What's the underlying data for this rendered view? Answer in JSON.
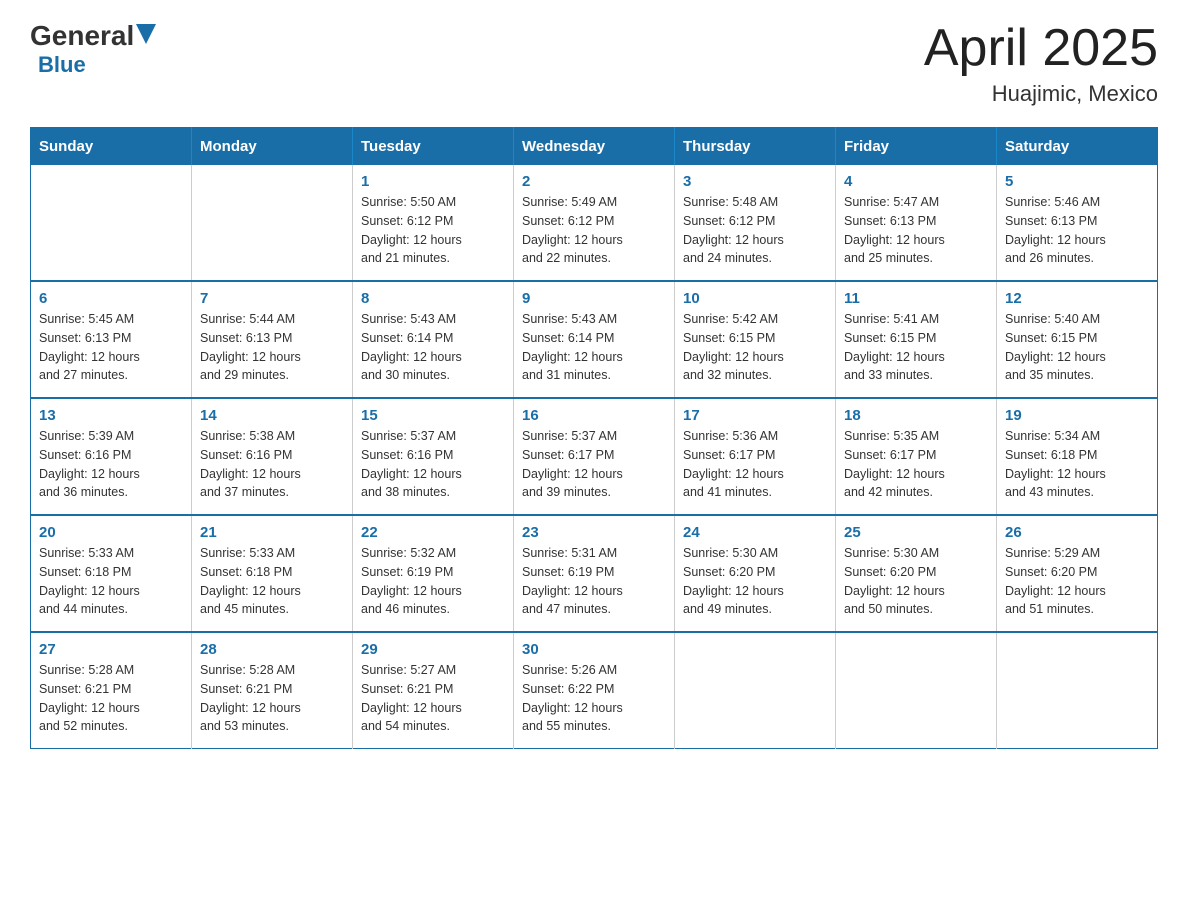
{
  "logo": {
    "general": "General",
    "blue": "Blue"
  },
  "title": {
    "month": "April 2025",
    "location": "Huajimic, Mexico"
  },
  "weekdays": [
    "Sunday",
    "Monday",
    "Tuesday",
    "Wednesday",
    "Thursday",
    "Friday",
    "Saturday"
  ],
  "weeks": [
    [
      {
        "day": "",
        "info": ""
      },
      {
        "day": "",
        "info": ""
      },
      {
        "day": "1",
        "info": "Sunrise: 5:50 AM\nSunset: 6:12 PM\nDaylight: 12 hours\nand 21 minutes."
      },
      {
        "day": "2",
        "info": "Sunrise: 5:49 AM\nSunset: 6:12 PM\nDaylight: 12 hours\nand 22 minutes."
      },
      {
        "day": "3",
        "info": "Sunrise: 5:48 AM\nSunset: 6:12 PM\nDaylight: 12 hours\nand 24 minutes."
      },
      {
        "day": "4",
        "info": "Sunrise: 5:47 AM\nSunset: 6:13 PM\nDaylight: 12 hours\nand 25 minutes."
      },
      {
        "day": "5",
        "info": "Sunrise: 5:46 AM\nSunset: 6:13 PM\nDaylight: 12 hours\nand 26 minutes."
      }
    ],
    [
      {
        "day": "6",
        "info": "Sunrise: 5:45 AM\nSunset: 6:13 PM\nDaylight: 12 hours\nand 27 minutes."
      },
      {
        "day": "7",
        "info": "Sunrise: 5:44 AM\nSunset: 6:13 PM\nDaylight: 12 hours\nand 29 minutes."
      },
      {
        "day": "8",
        "info": "Sunrise: 5:43 AM\nSunset: 6:14 PM\nDaylight: 12 hours\nand 30 minutes."
      },
      {
        "day": "9",
        "info": "Sunrise: 5:43 AM\nSunset: 6:14 PM\nDaylight: 12 hours\nand 31 minutes."
      },
      {
        "day": "10",
        "info": "Sunrise: 5:42 AM\nSunset: 6:15 PM\nDaylight: 12 hours\nand 32 minutes."
      },
      {
        "day": "11",
        "info": "Sunrise: 5:41 AM\nSunset: 6:15 PM\nDaylight: 12 hours\nand 33 minutes."
      },
      {
        "day": "12",
        "info": "Sunrise: 5:40 AM\nSunset: 6:15 PM\nDaylight: 12 hours\nand 35 minutes."
      }
    ],
    [
      {
        "day": "13",
        "info": "Sunrise: 5:39 AM\nSunset: 6:16 PM\nDaylight: 12 hours\nand 36 minutes."
      },
      {
        "day": "14",
        "info": "Sunrise: 5:38 AM\nSunset: 6:16 PM\nDaylight: 12 hours\nand 37 minutes."
      },
      {
        "day": "15",
        "info": "Sunrise: 5:37 AM\nSunset: 6:16 PM\nDaylight: 12 hours\nand 38 minutes."
      },
      {
        "day": "16",
        "info": "Sunrise: 5:37 AM\nSunset: 6:17 PM\nDaylight: 12 hours\nand 39 minutes."
      },
      {
        "day": "17",
        "info": "Sunrise: 5:36 AM\nSunset: 6:17 PM\nDaylight: 12 hours\nand 41 minutes."
      },
      {
        "day": "18",
        "info": "Sunrise: 5:35 AM\nSunset: 6:17 PM\nDaylight: 12 hours\nand 42 minutes."
      },
      {
        "day": "19",
        "info": "Sunrise: 5:34 AM\nSunset: 6:18 PM\nDaylight: 12 hours\nand 43 minutes."
      }
    ],
    [
      {
        "day": "20",
        "info": "Sunrise: 5:33 AM\nSunset: 6:18 PM\nDaylight: 12 hours\nand 44 minutes."
      },
      {
        "day": "21",
        "info": "Sunrise: 5:33 AM\nSunset: 6:18 PM\nDaylight: 12 hours\nand 45 minutes."
      },
      {
        "day": "22",
        "info": "Sunrise: 5:32 AM\nSunset: 6:19 PM\nDaylight: 12 hours\nand 46 minutes."
      },
      {
        "day": "23",
        "info": "Sunrise: 5:31 AM\nSunset: 6:19 PM\nDaylight: 12 hours\nand 47 minutes."
      },
      {
        "day": "24",
        "info": "Sunrise: 5:30 AM\nSunset: 6:20 PM\nDaylight: 12 hours\nand 49 minutes."
      },
      {
        "day": "25",
        "info": "Sunrise: 5:30 AM\nSunset: 6:20 PM\nDaylight: 12 hours\nand 50 minutes."
      },
      {
        "day": "26",
        "info": "Sunrise: 5:29 AM\nSunset: 6:20 PM\nDaylight: 12 hours\nand 51 minutes."
      }
    ],
    [
      {
        "day": "27",
        "info": "Sunrise: 5:28 AM\nSunset: 6:21 PM\nDaylight: 12 hours\nand 52 minutes."
      },
      {
        "day": "28",
        "info": "Sunrise: 5:28 AM\nSunset: 6:21 PM\nDaylight: 12 hours\nand 53 minutes."
      },
      {
        "day": "29",
        "info": "Sunrise: 5:27 AM\nSunset: 6:21 PM\nDaylight: 12 hours\nand 54 minutes."
      },
      {
        "day": "30",
        "info": "Sunrise: 5:26 AM\nSunset: 6:22 PM\nDaylight: 12 hours\nand 55 minutes."
      },
      {
        "day": "",
        "info": ""
      },
      {
        "day": "",
        "info": ""
      },
      {
        "day": "",
        "info": ""
      }
    ]
  ]
}
